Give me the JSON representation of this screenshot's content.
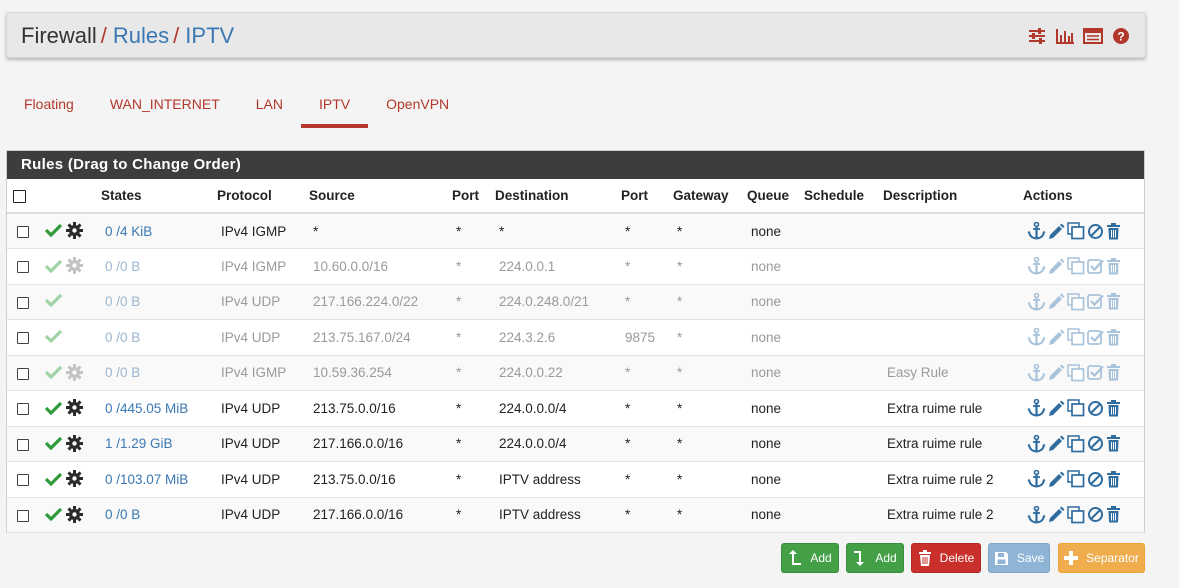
{
  "breadcrumb": {
    "items": [
      "Firewall",
      "Rules",
      "IPTV"
    ],
    "separator": "/"
  },
  "header_icons": [
    "sliders-icon",
    "bar-chart-icon",
    "list-table-icon",
    "help-icon"
  ],
  "tabs": [
    {
      "label": "Floating",
      "active": false
    },
    {
      "label": "WAN_INTERNET",
      "active": false
    },
    {
      "label": "LAN",
      "active": false
    },
    {
      "label": "IPTV",
      "active": true
    },
    {
      "label": "OpenVPN",
      "active": false
    }
  ],
  "rules": {
    "heading": "Rules (Drag to Change Order)",
    "columns": [
      "States",
      "Protocol",
      "Source",
      "Port",
      "Destination",
      "Port",
      "Gateway",
      "Queue",
      "Schedule",
      "Description",
      "Actions"
    ],
    "rows": [
      {
        "enabled": true,
        "has_gear": true,
        "states": "0 /4 KiB",
        "protocol": "IPv4 IGMP",
        "source": "*",
        "sport": "*",
        "destination": "*",
        "dport": "*",
        "gateway": "*",
        "queue": "none",
        "schedule": "",
        "description": ""
      },
      {
        "enabled": false,
        "has_gear": true,
        "states": "0 /0 B",
        "protocol": "IPv4 IGMP",
        "source": "10.60.0.0/16",
        "sport": "*",
        "destination": "224.0.0.1",
        "dport": "*",
        "gateway": "*",
        "queue": "none",
        "schedule": "",
        "description": ""
      },
      {
        "enabled": false,
        "has_gear": false,
        "states": "0 /0 B",
        "protocol": "IPv4 UDP",
        "source": "217.166.224.0/22",
        "sport": "*",
        "destination": "224.0.248.0/21",
        "dport": "*",
        "gateway": "*",
        "queue": "none",
        "schedule": "",
        "description": ""
      },
      {
        "enabled": false,
        "has_gear": false,
        "states": "0 /0 B",
        "protocol": "IPv4 UDP",
        "source": "213.75.167.0/24",
        "sport": "*",
        "destination": "224.3.2.6",
        "dport": "9875",
        "gateway": "*",
        "queue": "none",
        "schedule": "",
        "description": ""
      },
      {
        "enabled": false,
        "has_gear": true,
        "states": "0 /0 B",
        "protocol": "IPv4 IGMP",
        "source": "10.59.36.254",
        "sport": "*",
        "destination": "224.0.0.22",
        "dport": "*",
        "gateway": "*",
        "queue": "none",
        "schedule": "",
        "description": "Easy Rule"
      },
      {
        "enabled": true,
        "has_gear": true,
        "states": "0 /445.05 MiB",
        "protocol": "IPv4 UDP",
        "source": "213.75.0.0/16",
        "sport": "*",
        "destination": "224.0.0.0/4",
        "dport": "*",
        "gateway": "*",
        "queue": "none",
        "schedule": "",
        "description": "Extra ruime rule"
      },
      {
        "enabled": true,
        "has_gear": true,
        "states": "1 /1.29 GiB",
        "protocol": "IPv4 UDP",
        "source": "217.166.0.0/16",
        "sport": "*",
        "destination": "224.0.0.0/4",
        "dport": "*",
        "gateway": "*",
        "queue": "none",
        "schedule": "",
        "description": "Extra ruime rule"
      },
      {
        "enabled": true,
        "has_gear": true,
        "states": "0 /103.07 MiB",
        "protocol": "IPv4 UDP",
        "source": "213.75.0.0/16",
        "sport": "*",
        "destination": "IPTV address",
        "dport": "*",
        "gateway": "*",
        "queue": "none",
        "schedule": "",
        "description": "Extra ruime rule 2"
      },
      {
        "enabled": true,
        "has_gear": true,
        "states": "0 /0 B",
        "protocol": "IPv4 UDP",
        "source": "217.166.0.0/16",
        "sport": "*",
        "destination": "IPTV address",
        "dport": "*",
        "gateway": "*",
        "queue": "none",
        "schedule": "",
        "description": "Extra ruime rule 2"
      }
    ]
  },
  "buttons": {
    "add_top": "Add",
    "add_bottom": "Add",
    "delete": "Delete",
    "save": "Save",
    "separator": "Separator"
  },
  "colors": {
    "accent_red": "#b3382c",
    "link_blue": "#3a78b4",
    "check_green": "#2e9a3a",
    "heading_dark": "#3d3d3d"
  }
}
